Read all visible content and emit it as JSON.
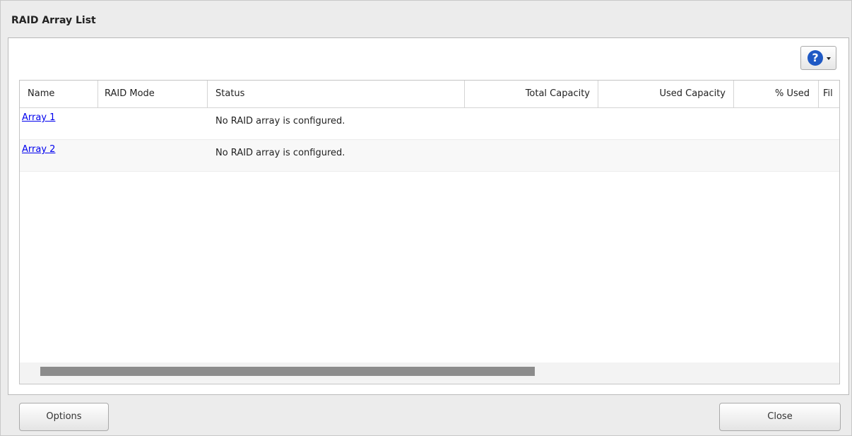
{
  "dialog": {
    "title": "RAID Array List"
  },
  "toolbar": {
    "help_icon": "question-circle-icon",
    "help_glyph": "?",
    "help_color": "#1f59c4"
  },
  "table": {
    "columns": [
      "Name",
      "RAID Mode",
      "Status",
      "Total Capacity",
      "Used Capacity",
      "% Used",
      "Fil"
    ],
    "rows": [
      {
        "name": "Array 1",
        "raid_mode": "",
        "status": "No RAID array is configured."
      },
      {
        "name": "Array 2",
        "raid_mode": "",
        "status": "No RAID array is configured."
      }
    ]
  },
  "footer": {
    "options_label": "Options",
    "close_label": "Close"
  },
  "colors": {
    "link": "#0000ee",
    "background": "#ececec"
  }
}
